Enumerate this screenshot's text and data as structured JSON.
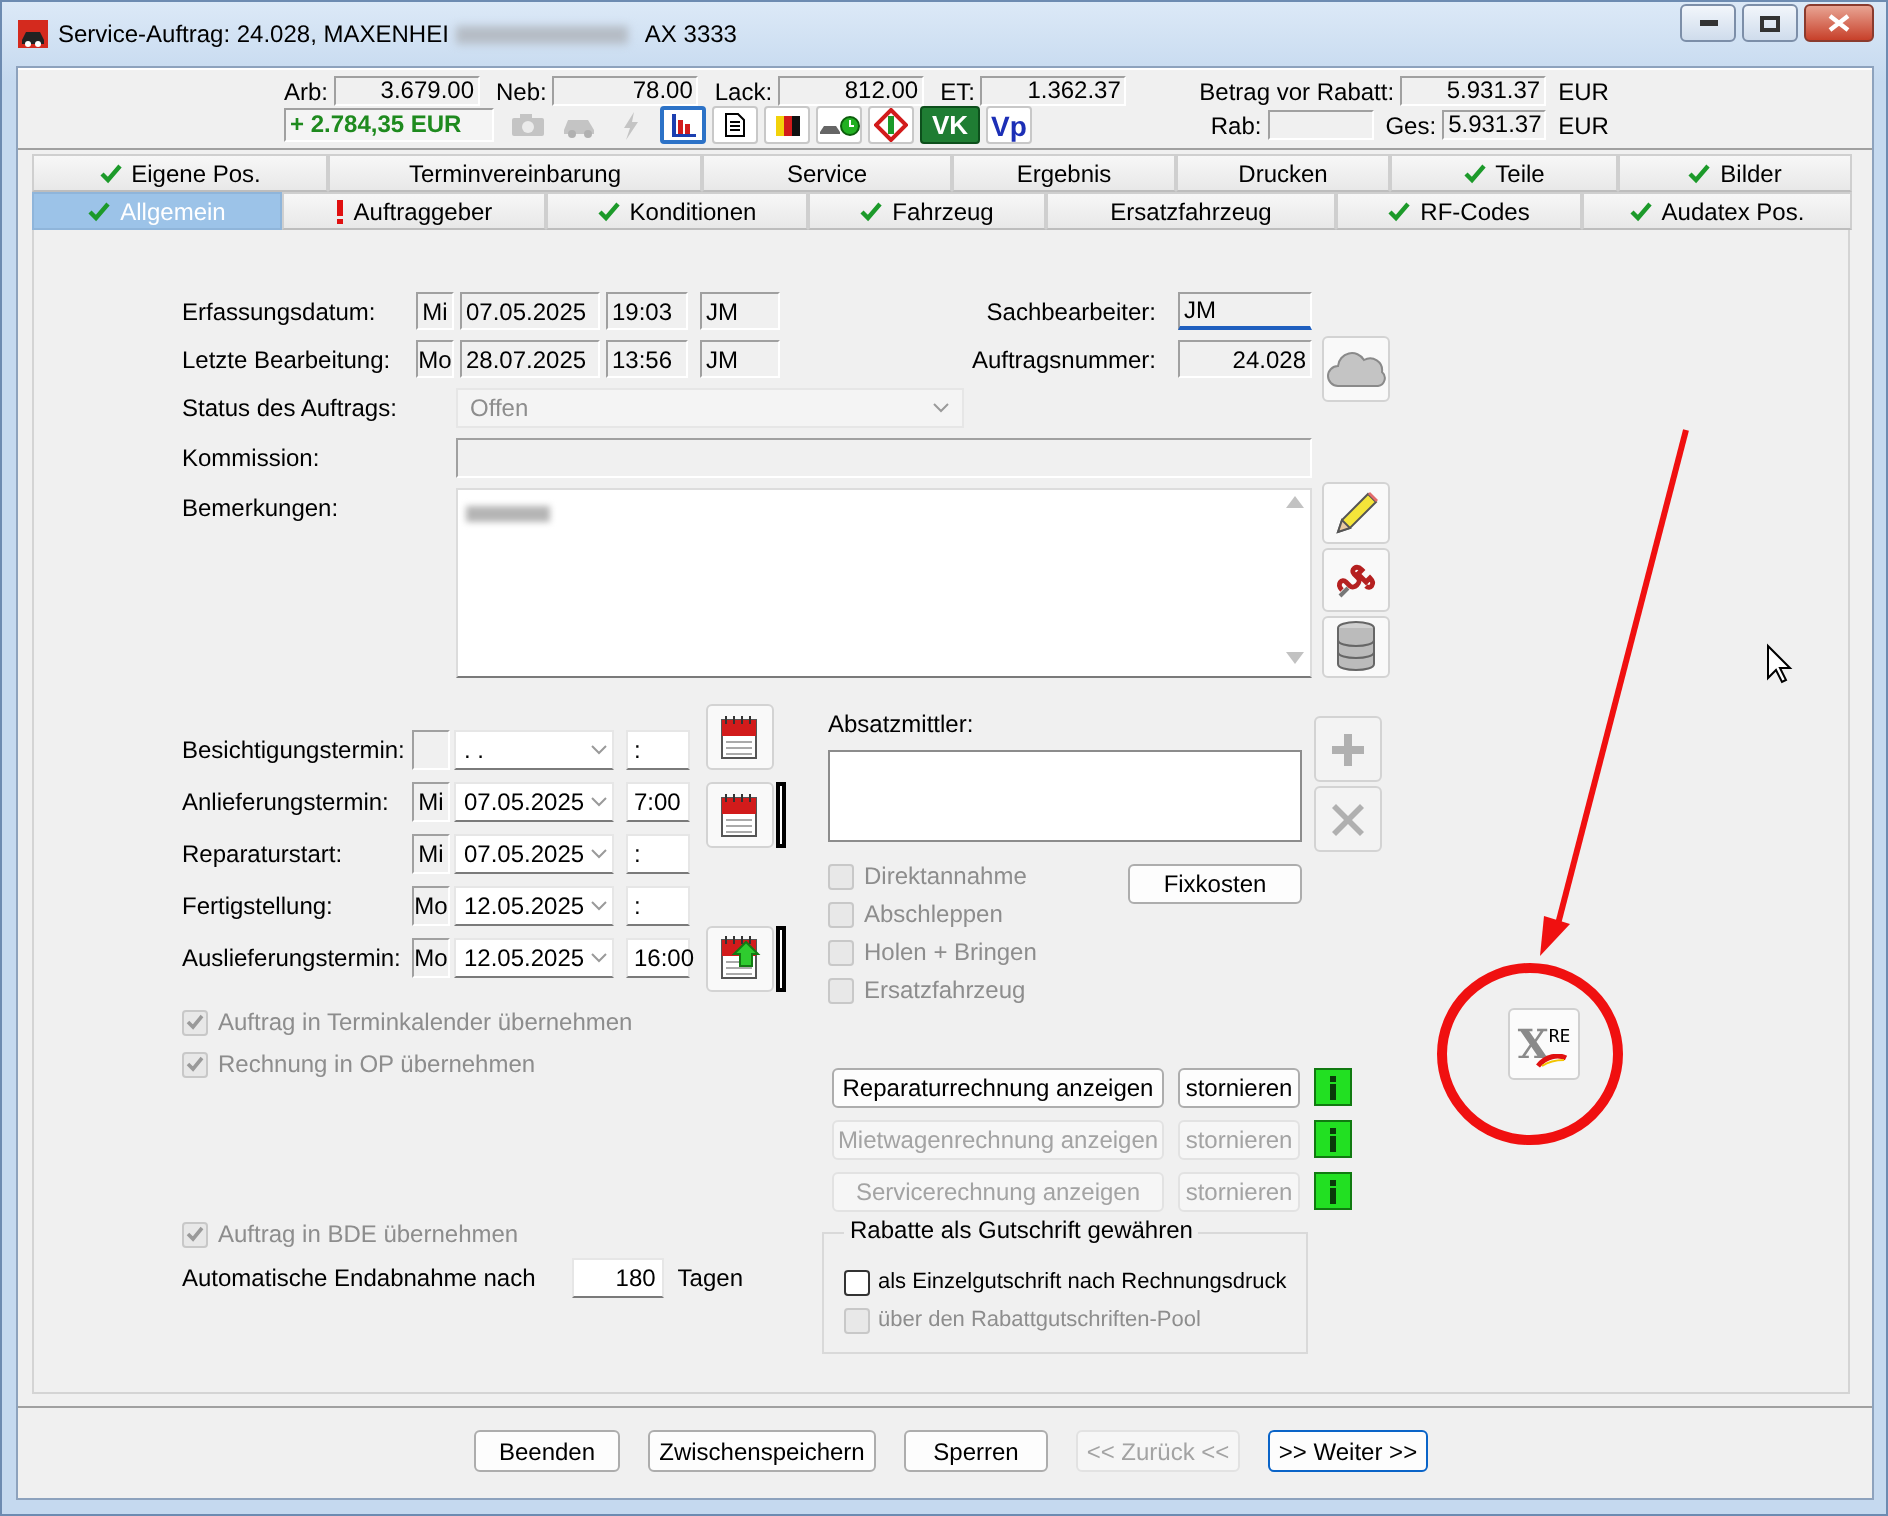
{
  "window": {
    "title": "Service-Auftrag: 24.028, MAXENHEI",
    "title_end": "AX 3333"
  },
  "summary": {
    "amounts": [
      {
        "label": "Arb:",
        "value": "3.679.00"
      },
      {
        "label": "Neb:",
        "value": "78.00"
      },
      {
        "label": "Lack:",
        "value": "812.00"
      },
      {
        "label": "ET:",
        "value": "1.362.37"
      }
    ],
    "profit": "+ 2.784,35 EUR",
    "toolbar": [
      {
        "kind": "camera",
        "disabled": true,
        "selected": false
      },
      {
        "kind": "car",
        "disabled": true,
        "selected": false
      },
      {
        "kind": "bolt",
        "disabled": true,
        "selected": false
      },
      {
        "kind": "chart",
        "disabled": false,
        "selected": true
      },
      {
        "kind": "document",
        "disabled": false,
        "selected": false
      },
      {
        "kind": "colorbars",
        "disabled": false,
        "selected": false
      },
      {
        "kind": "carclock",
        "disabled": false,
        "selected": false
      },
      {
        "kind": "diamond",
        "disabled": false,
        "selected": false
      },
      {
        "kind": "vk",
        "label": "VK",
        "disabled": false,
        "selected": false
      },
      {
        "kind": "vp",
        "label": "Vp",
        "disabled": false,
        "selected": false
      }
    ],
    "before_discount": {
      "label": "Betrag vor Rabatt:",
      "value": "5.931.37",
      "currency": "EUR"
    },
    "discount": {
      "label": "Rab:"
    },
    "total": {
      "label": "Ges:",
      "value": "5.931.37",
      "currency": "EUR"
    }
  },
  "tabs": [
    [
      {
        "label": "Eigene Pos.",
        "done": true,
        "attention": false,
        "selected": false
      },
      {
        "label": "Terminvereinbarung",
        "done": false,
        "attention": false,
        "selected": false
      },
      {
        "label": "Service",
        "done": false,
        "attention": false,
        "selected": false
      },
      {
        "label": "Ergebnis",
        "done": false,
        "attention": false,
        "selected": false
      },
      {
        "label": "Drucken",
        "done": false,
        "attention": false,
        "selected": false
      },
      {
        "label": "Teile",
        "done": true,
        "attention": false,
        "selected": false
      },
      {
        "label": "Bilder",
        "done": true,
        "attention": false,
        "selected": false
      }
    ],
    [
      {
        "label": "Allgemein",
        "done": true,
        "attention": false,
        "selected": true
      },
      {
        "label": "Auftraggeber",
        "done": false,
        "attention": true,
        "selected": false
      },
      {
        "label": "Konditionen",
        "done": true,
        "attention": false,
        "selected": false
      },
      {
        "label": "Fahrzeug",
        "done": true,
        "attention": false,
        "selected": false
      },
      {
        "label": "Ersatzfahrzeug",
        "done": false,
        "attention": false,
        "selected": false
      },
      {
        "label": "RF-Codes",
        "done": true,
        "attention": false,
        "selected": false
      },
      {
        "label": "Audatex Pos.",
        "done": true,
        "attention": false,
        "selected": false
      }
    ]
  ],
  "general": {
    "records": [
      {
        "label": "Erfassungsdatum:",
        "day": "Mi",
        "date": "07.05.2025",
        "time": "19:03",
        "user": "JM"
      },
      {
        "label": "Letzte Bearbeitung:",
        "day": "Mo",
        "date": "28.07.2025",
        "time": "13:56",
        "user": "JM"
      }
    ],
    "clerk": {
      "label": "Sachbearbeiter:",
      "value": "JM",
      "focused": true
    },
    "order_number": {
      "label": "Auftragsnummer:",
      "value": "24.028"
    },
    "status": {
      "label": "Status des Auftrags:",
      "value": "Offen",
      "disabled": true
    },
    "commission": {
      "label": "Kommission:"
    },
    "remarks": {
      "label": "Bemerkungen:"
    },
    "appointments": [
      {
        "label": "Besichtigungstermin:",
        "date": ". .",
        "time": ":",
        "calendar": true,
        "indicator": false,
        "arrow": false
      },
      {
        "label": "Anlieferungstermin:",
        "day": "Mi",
        "date": "07.05.2025",
        "time": "7:00",
        "calendar": true,
        "indicator": true,
        "arrow": false
      },
      {
        "label": "Reparaturstart:",
        "day": "Mi",
        "date": "07.05.2025",
        "time": ":",
        "calendar": false,
        "indicator": false,
        "arrow": false
      },
      {
        "label": "Fertigstellung:",
        "day": "Mo",
        "date": "12.05.2025",
        "time": ":",
        "calendar": false,
        "indicator": false,
        "arrow": false
      },
      {
        "label": "Auslieferungstermin:",
        "day": "Mo",
        "date": "12.05.2025",
        "time": "16:00",
        "calendar": true,
        "indicator": true,
        "arrow": true
      }
    ],
    "left_checks": [
      {
        "label": "Auftrag in Terminkalender übernehmen",
        "checked": true,
        "disabled": true
      },
      {
        "label": "Rechnung in OP übernehmen",
        "checked": true,
        "disabled": true
      }
    ],
    "agent": {
      "label": "Absatzmittler:"
    },
    "options": [
      {
        "label": "Direktannahme",
        "checked": false,
        "disabled": true
      },
      {
        "label": "Abschleppen",
        "checked": false,
        "disabled": true
      },
      {
        "label": "Holen + Bringen",
        "checked": false,
        "disabled": true
      },
      {
        "label": "Ersatzfahrzeug",
        "checked": false,
        "disabled": true
      }
    ],
    "fixed_costs": "Fixkosten",
    "invoices": [
      {
        "show": "Reparaturrechnung anzeigen",
        "cancel": "stornieren",
        "disabled": false
      },
      {
        "show": "Mietwagenrechnung anzeigen",
        "cancel": "stornieren",
        "disabled": true
      },
      {
        "show": "Servicerechnung anzeigen",
        "cancel": "stornieren",
        "disabled": true
      }
    ],
    "bde": {
      "label": "Auftrag in BDE übernehmen",
      "checked": true,
      "disabled": true
    },
    "auto_acceptance": {
      "label": "Automatische Endabnahme nach",
      "value": "180",
      "unit": "Tagen"
    },
    "discount_group": {
      "title": "Rabatte als Gutschrift gewähren",
      "options": [
        {
          "label": "als Einzelgutschrift nach Rechnungsdruck",
          "checked": false,
          "disabled": false
        },
        {
          "label": "über den Rabattgutschriften-Pool",
          "checked": false,
          "disabled": true
        }
      ]
    },
    "extra_button": {
      "mark": "X",
      "suffix": "RE"
    }
  },
  "buttons": [
    {
      "label": "Beenden",
      "disabled": false,
      "default": false
    },
    {
      "label": "Zwischenspeichern",
      "disabled": false,
      "default": false
    },
    {
      "label": "Sperren",
      "disabled": false,
      "default": false
    },
    {
      "label": "<< Zurück <<",
      "disabled": true,
      "default": false
    },
    {
      "label": ">> Weiter >>",
      "disabled": false,
      "default": true
    }
  ]
}
